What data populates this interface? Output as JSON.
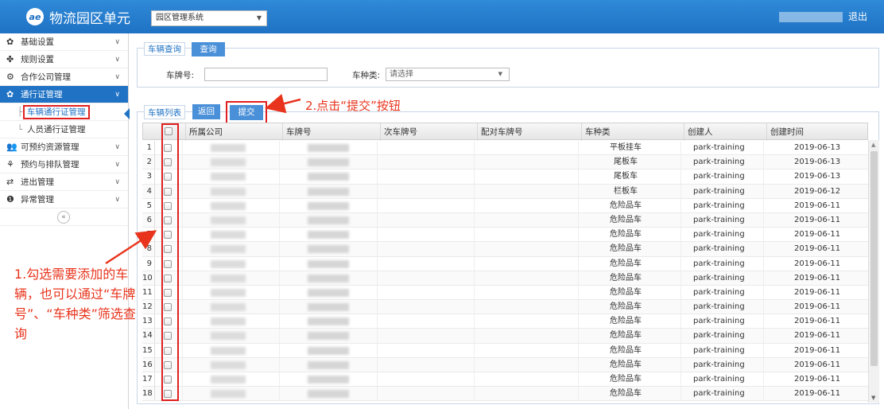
{
  "header": {
    "logo_text": "ae",
    "title": "物流园区单元",
    "system_select": "园区管理系统",
    "logout": "退出"
  },
  "sidebar": {
    "items": [
      {
        "label": "基础设置",
        "icon": "gear-icon",
        "glyph": "✿"
      },
      {
        "label": "规则设置",
        "icon": "gamepad-icon",
        "glyph": "✤"
      },
      {
        "label": "合作公司管理",
        "icon": "cogs-icon",
        "glyph": "⚙"
      },
      {
        "label": "通行证管理",
        "icon": "gear-icon",
        "glyph": "✿",
        "active": true
      },
      {
        "label": "可预约资源管理",
        "icon": "users-icon",
        "glyph": "👥"
      },
      {
        "label": "预约与排队管理",
        "icon": "queue-icon",
        "glyph": "⚘"
      },
      {
        "label": "进出管理",
        "icon": "exchange-icon",
        "glyph": "⇄"
      },
      {
        "label": "异常管理",
        "icon": "alert-icon",
        "glyph": "❶"
      }
    ],
    "sub_items": [
      "车辆通行证管理",
      "人员通行证管理"
    ],
    "collapse": "«"
  },
  "query": {
    "tab": "车辆查询",
    "button": "查询",
    "plate_label": "车牌号:",
    "plate_value": "",
    "type_label": "车种类:",
    "type_placeholder": "请选择"
  },
  "list": {
    "tab": "车辆列表",
    "back": "返回",
    "submit": "提交",
    "columns": [
      "所属公司",
      "车牌号",
      "次车牌号",
      "配对车牌号",
      "车种类",
      "创建人",
      "创建时间"
    ],
    "rows": [
      {
        "n": "1",
        "type": "平板挂车",
        "creator": "park-training",
        "date": "2019-06-13"
      },
      {
        "n": "2",
        "type": "尾板车",
        "creator": "park-training",
        "date": "2019-06-13"
      },
      {
        "n": "3",
        "type": "尾板车",
        "creator": "park-training",
        "date": "2019-06-13"
      },
      {
        "n": "4",
        "type": "栏板车",
        "creator": "park-training",
        "date": "2019-06-12"
      },
      {
        "n": "5",
        "type": "危险品车",
        "creator": "park-training",
        "date": "2019-06-11"
      },
      {
        "n": "6",
        "type": "危险品车",
        "creator": "park-training",
        "date": "2019-06-11"
      },
      {
        "n": "7",
        "type": "危险品车",
        "creator": "park-training",
        "date": "2019-06-11"
      },
      {
        "n": "8",
        "type": "危险品车",
        "creator": "park-training",
        "date": "2019-06-11"
      },
      {
        "n": "9",
        "type": "危险品车",
        "creator": "park-training",
        "date": "2019-06-11"
      },
      {
        "n": "10",
        "type": "危险品车",
        "creator": "park-training",
        "date": "2019-06-11"
      },
      {
        "n": "11",
        "type": "危险品车",
        "creator": "park-training",
        "date": "2019-06-11"
      },
      {
        "n": "12",
        "type": "危险品车",
        "creator": "park-training",
        "date": "2019-06-11"
      },
      {
        "n": "13",
        "type": "危险品车",
        "creator": "park-training",
        "date": "2019-06-11"
      },
      {
        "n": "14",
        "type": "危险品车",
        "creator": "park-training",
        "date": "2019-06-11"
      },
      {
        "n": "15",
        "type": "危险品车",
        "creator": "park-training",
        "date": "2019-06-11"
      },
      {
        "n": "16",
        "type": "危险品车",
        "creator": "park-training",
        "date": "2019-06-11"
      },
      {
        "n": "17",
        "type": "危险品车",
        "creator": "park-training",
        "date": "2019-06-11"
      },
      {
        "n": "18",
        "type": "危险品车",
        "creator": "park-training",
        "date": "2019-06-11"
      }
    ]
  },
  "annotations": {
    "step1": "1.勾选需要添加的车辆，也可以通过“车牌号”、“车种类”筛选查询",
    "step2": "2.点击“提交”按钮",
    "color": "#e8341c"
  },
  "colors": {
    "header": "#1f72c4",
    "accent": "#4a90d9",
    "highlight": "#e02020"
  }
}
